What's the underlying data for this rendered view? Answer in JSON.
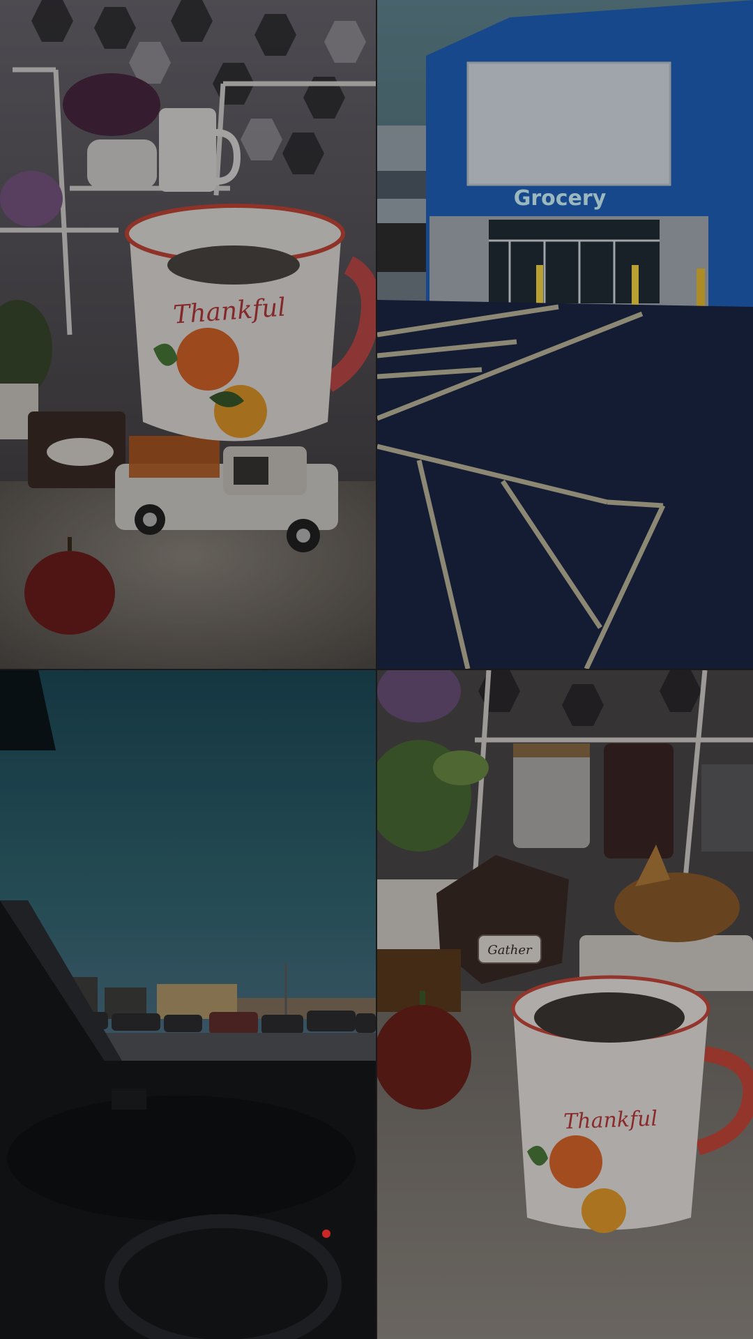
{
  "collage": {
    "tiles": [
      {
        "id": "top-left",
        "subject": "mug-on-truck-shelf"
      },
      {
        "id": "top-right",
        "subject": "store-parking-lot"
      },
      {
        "id": "bottom-left",
        "subject": "car-windshield-view"
      },
      {
        "id": "bottom-right",
        "subject": "mug-on-counter"
      }
    ]
  },
  "texts": {
    "mug_script_1": "Thankful",
    "store_sign": "Grocery",
    "tag": "Gather",
    "mug_script_2": "Thankful"
  },
  "colors": {
    "store_blue": "#1f5ab0",
    "asphalt": "#1a2440",
    "mug_white": "#e9e6e3",
    "mug_red": "#c6473a",
    "pumpkin_orange": "#d9662a",
    "sky_teal": "#2f7a8a"
  }
}
